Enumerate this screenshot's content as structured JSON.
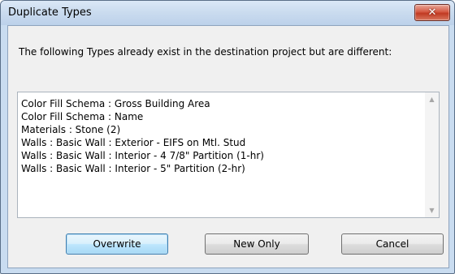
{
  "window": {
    "title": "Duplicate Types",
    "close_glyph": "✕"
  },
  "message": "The following Types already exist in the destination project but are different:",
  "types_list": [
    "Color Fill Schema : Gross Building Area",
    "Color Fill Schema : Name",
    "Materials : Stone (2)",
    "Walls : Basic Wall : Exterior - EIFS on Mtl. Stud",
    "Walls : Basic Wall : Interior - 4 7/8\" Partition (1-hr)",
    "Walls : Basic Wall : Interior - 5\" Partition (2-hr)"
  ],
  "scrollbar": {
    "up_glyph": "▲",
    "down_glyph": "▼"
  },
  "buttons": {
    "overwrite": "Overwrite",
    "new_only": "New Only",
    "cancel": "Cancel"
  },
  "colors": {
    "title_bar": "#cbdcef",
    "close_button": "#c94a33",
    "default_button_border": "#3c7fb1",
    "client_background": "#f0f0f0"
  }
}
